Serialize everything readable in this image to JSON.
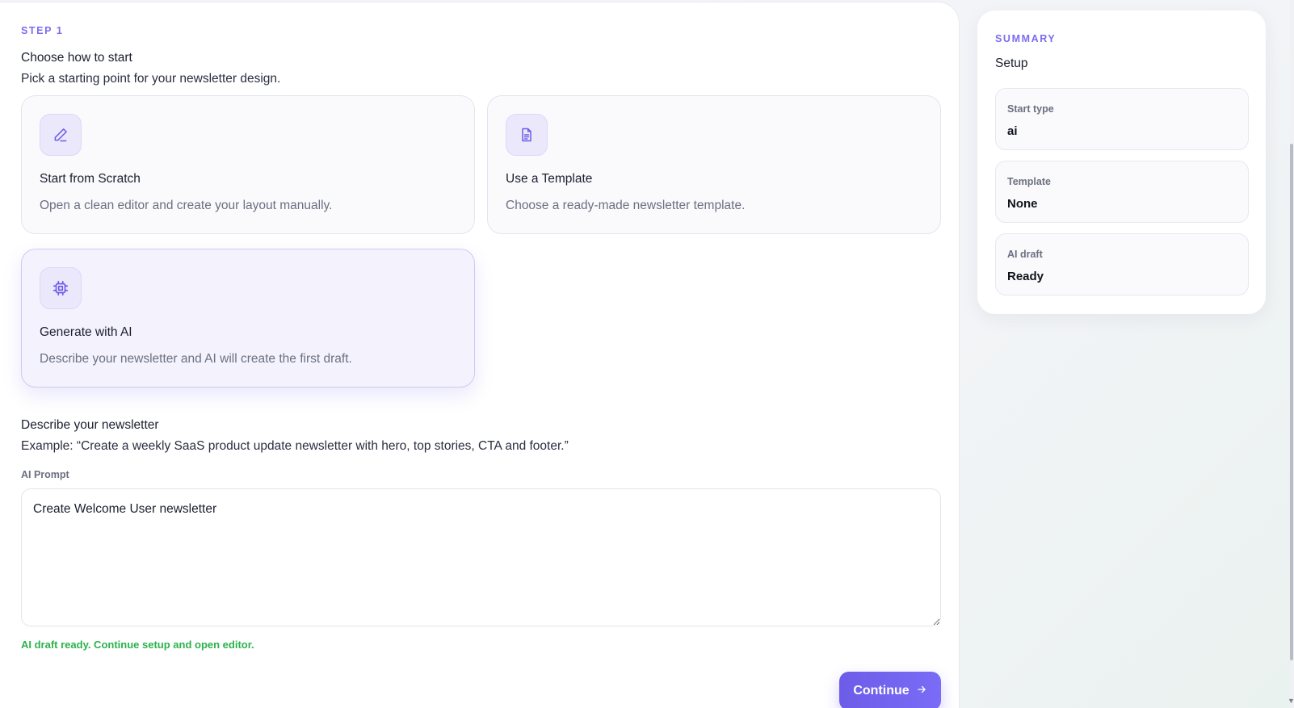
{
  "step": {
    "label": "STEP 1",
    "title": "Choose how to start",
    "subtitle": "Pick a starting point for your newsletter design."
  },
  "options": [
    {
      "icon": "pencil-icon",
      "title": "Start from Scratch",
      "description": "Open a clean editor and create your layout manually.",
      "selected": false
    },
    {
      "icon": "document-icon",
      "title": "Use a Template",
      "description": "Choose a ready-made newsletter template.",
      "selected": false
    },
    {
      "icon": "cpu-chip-icon",
      "title": "Generate with AI",
      "description": "Describe your newsletter and AI will create the first draft.",
      "selected": true
    }
  ],
  "prompt": {
    "heading": "Describe your newsletter",
    "example": "Example: “Create a weekly SaaS product update newsletter with hero, top stories, CTA and footer.”",
    "field_label": "AI Prompt",
    "value": "Create Welcome User newsletter"
  },
  "status_message": "AI draft ready. Continue setup and open editor.",
  "continue_button": {
    "label": "Continue",
    "icon": "arrow-right-icon"
  },
  "summary": {
    "label": "SUMMARY",
    "title": "Setup",
    "items": [
      {
        "label": "Start type",
        "value": "ai"
      },
      {
        "label": "Template",
        "value": "None"
      },
      {
        "label": "AI draft",
        "value": "Ready"
      }
    ]
  },
  "colors": {
    "accent": "#7c6cf0",
    "button": "#6c5ce7",
    "success": "#2bb24c",
    "icon_bg": "#ebe8fc"
  }
}
